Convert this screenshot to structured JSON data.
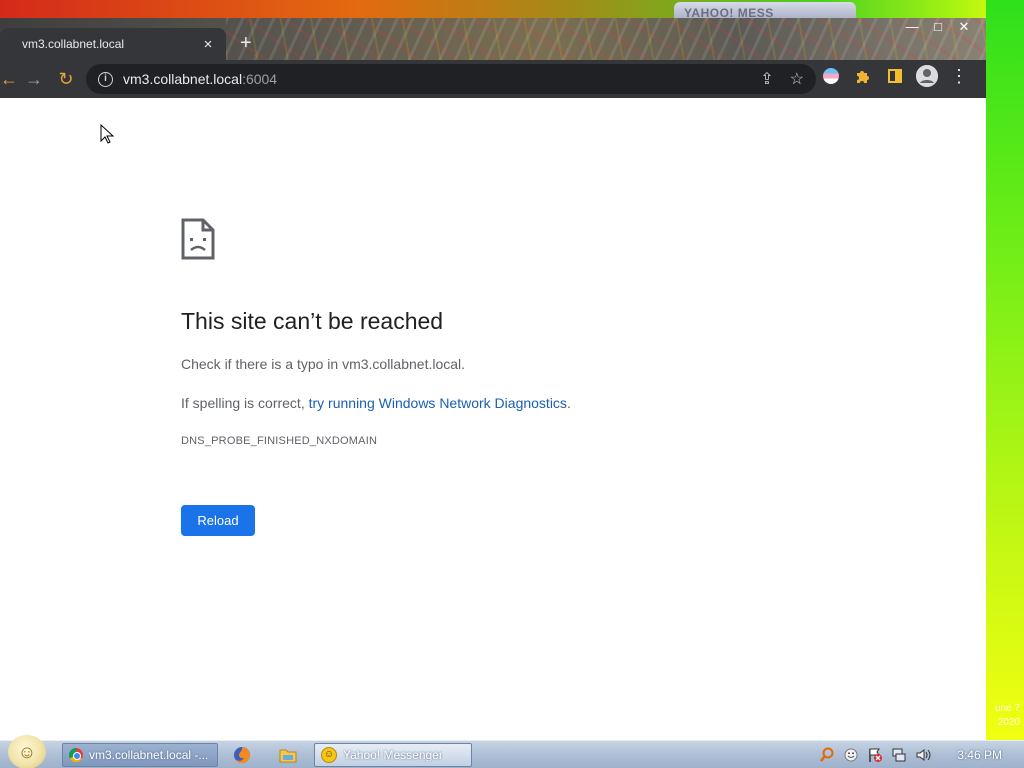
{
  "desktop": {
    "corner_date": [
      "une 7",
      "2020"
    ],
    "background_tab_label": "YAHOO! MESS"
  },
  "browser": {
    "tab": {
      "title": "vm3.collabnet.local",
      "close_glyph": "×"
    },
    "new_tab_glyph": "+",
    "window_controls": {
      "minimize": "—",
      "maximize": "□",
      "close": "✕"
    },
    "toolbar": {
      "back_glyph": "←",
      "forward_glyph": "→",
      "reload_glyph": "↻",
      "url_host": "vm3.collabnet.local",
      "url_port": ":6004",
      "share_glyph": "⇪",
      "bookmark_glyph": "☆",
      "menu_glyph": "⋮"
    },
    "page": {
      "headline": "This site can’t be reached",
      "message1": "Check if there is a typo in vm3.collabnet.local.",
      "message2_prefix": "If spelling is correct, ",
      "message2_link": "try running Windows Network Diagnostics",
      "message2_suffix": ".",
      "error_code": "DNS_PROBE_FINISHED_NXDOMAIN",
      "reload_label": "Reload"
    },
    "colors": {
      "accent": "#1a73e8",
      "link": "#1a5fb4"
    }
  },
  "taskbar": {
    "buttons": [
      {
        "label": "vm3.collabnet.local -...",
        "icon": "chrome-icon",
        "active": true
      },
      {
        "label": "Yahoo! Messenger",
        "icon": "yahoo-messenger-icon",
        "active": false
      }
    ],
    "quick_launch": [
      "firefox-icon",
      "folder-icon"
    ],
    "tray_icons": [
      "search-icon",
      "messenger-tray-icon",
      "security-flag-icon",
      "network-icon",
      "volume-icon"
    ],
    "clock": "3:46 PM"
  }
}
